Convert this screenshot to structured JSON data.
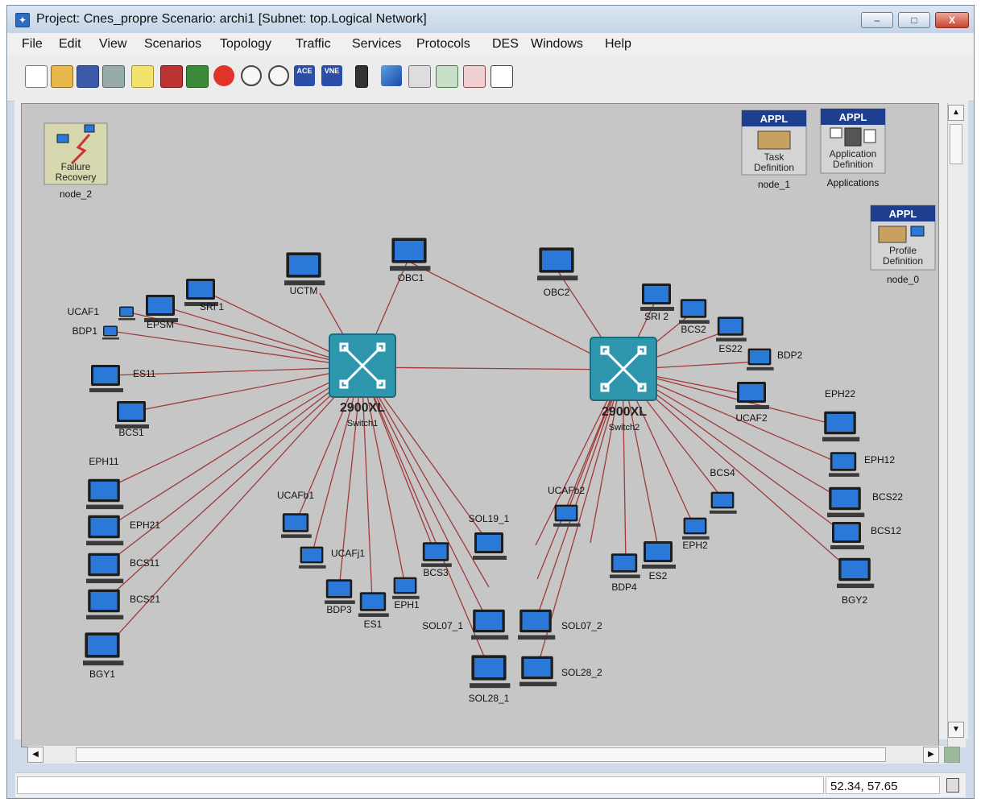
{
  "window": {
    "title": "Project: Cnes_propre Scenario: archi1  [Subnet: top.Logical Network]",
    "minimize_glyph": "–",
    "maximize_glyph": "□",
    "close_glyph": "X"
  },
  "menu": [
    "File",
    "Edit",
    "View",
    "Scenarios",
    "Topology",
    "Traffic",
    "Services",
    "Protocols",
    "DES",
    "Windows",
    "Help"
  ],
  "toolbar": {
    "icons": [
      "new-icon",
      "open-icon",
      "save-icon",
      "print-icon",
      "object-palette-icon",
      "configure-icon",
      "save-image-icon",
      "locate-icon",
      "zoom-in-icon",
      "zoom-out-icon",
      "ace-import-icon",
      "vne-icon",
      "traffic-light-icon",
      "topology-icon",
      "marker-icon",
      "results-icon",
      "view-results-icon",
      "report-icon"
    ],
    "ace_label": "ACE",
    "vne_label": "VNE"
  },
  "network": {
    "switch1": {
      "model": "2900XL",
      "name": "Switch1"
    },
    "switch2": {
      "model": "2900XL",
      "name": "Switch2"
    },
    "special_nodes": {
      "failure": {
        "line1": "Failure",
        "line2": "Recovery",
        "name": "node_2"
      },
      "task": {
        "header": "APPL",
        "line1": "Task",
        "line2": "Definition",
        "name": "node_1"
      },
      "application": {
        "header": "APPL",
        "line1": "Application",
        "line2": "Definition",
        "name": "Applications"
      },
      "profile": {
        "header": "APPL",
        "line1": "Profile",
        "line2": "Definition",
        "name": "node_0"
      }
    },
    "switch1_clients": [
      "SRI 1",
      "EPSM",
      "UCAF1",
      "BDP1",
      "ES11",
      "BCS1",
      "UCTM",
      "OBC1",
      "EPH11",
      "EPH21",
      "BCS11",
      "BCS21",
      "BGY1",
      "UCAFb1",
      "UCAFj1",
      "BDP3",
      "ES1",
      "EPH1",
      "BCS3",
      "SOL19_1",
      "SOL07_1",
      "SOL28_1"
    ],
    "switch2_clients": [
      "OBC2",
      "SRI 2",
      "BCS2",
      "ES22",
      "BDP2",
      "UCAF2",
      "EPH22",
      "EPH12",
      "BCS22",
      "BCS12",
      "BGY2",
      "BCS4",
      "EPH2",
      "ES2",
      "BDP4",
      "UCAFb2",
      "SOL07_2",
      "SOL28_2"
    ]
  },
  "status": {
    "coordinates": "52.34, 57.65"
  },
  "colors": {
    "link": "#a03a3a",
    "switch": "#2f97ad",
    "monitor": "#2a79d8",
    "canvas": "#c6c6c6",
    "appl_header": "#1e3f8f"
  }
}
